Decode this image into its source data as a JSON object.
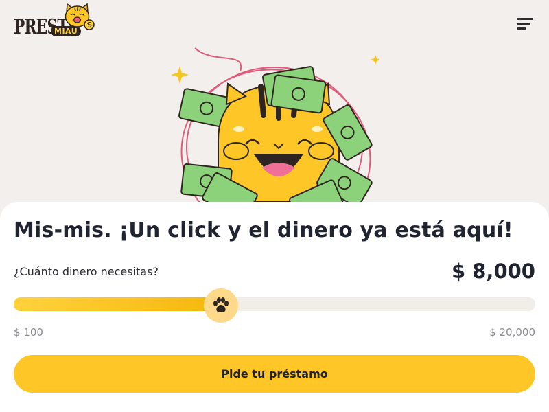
{
  "brand": {
    "word1": "PRESTA",
    "word2": "MIAU",
    "accent": "#ffc628"
  },
  "header": {
    "menu_icon": "hamburger-menu-icon"
  },
  "hero": {
    "illustration": "happy-cat-with-money"
  },
  "loan": {
    "title": "Mis-mis. ¡Un click y el dinero ya está aquí!",
    "question": "¿Cuánto dinero necesitas?",
    "amount_label": "$ 8,000",
    "amount_value": 8000,
    "min_label": "$ 100",
    "max_label": "$ 20,000",
    "min_value": 100,
    "max_value": 20000,
    "thumb_icon": "paw-icon",
    "cta_label": "Pide tu préstamo"
  }
}
